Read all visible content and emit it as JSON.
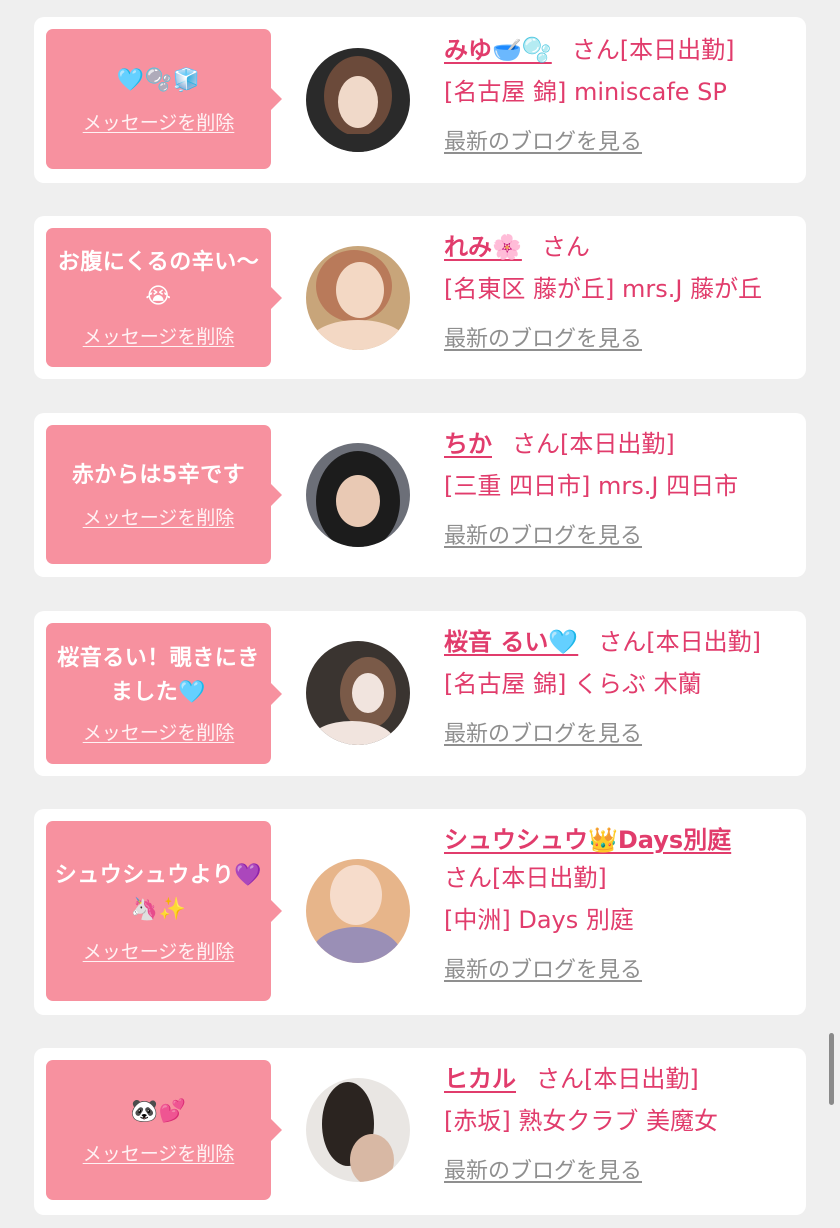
{
  "messages": [
    {
      "message": "🩵🫧🧊",
      "delete_label": "メッセージを削除",
      "name": "みゆ🥣🫧",
      "suffix": "さん[本日出勤]",
      "shop": "[名古屋 錦] miniscafe SP",
      "blog_label": "最新のブログを見る",
      "avatar_colors": [
        "#f0d9c9",
        "#6b4a3a",
        "#2a2a2a"
      ]
    },
    {
      "message": "お腹にくるの辛い〜😭",
      "delete_label": "メッセージを削除",
      "name": "れみ🌸",
      "suffix": "さん",
      "shop": "[名東区 藤が丘] mrs.J 藤が丘",
      "blog_label": "最新のブログを見る",
      "avatar_colors": [
        "#f3d8c4",
        "#b97a5a",
        "#c8a57a"
      ]
    },
    {
      "message": "赤からは5辛です",
      "delete_label": "メッセージを削除",
      "name": "ちか",
      "suffix": "さん[本日出勤]",
      "shop": "[三重 四日市] mrs.J 四日市",
      "blog_label": "最新のブログを見る",
      "avatar_colors": [
        "#6c6f78",
        "#1c1c1c",
        "#e9c9b4"
      ]
    },
    {
      "message": "桜音るい！覗きにきました🩵",
      "delete_label": "メッセージを削除",
      "name": "桜音 るい🩵",
      "suffix": "さん[本日出勤]",
      "shop": "[名古屋 錦] くらぶ 木蘭",
      "blog_label": "最新のブログを見る",
      "avatar_colors": [
        "#3a3430",
        "#f1e4de",
        "#7a5a48"
      ]
    },
    {
      "message": "シュウシュウより💜🦄✨",
      "delete_label": "メッセージを削除",
      "name": "シュウシュウ👑Days別庭",
      "suffix": "さん[本日出勤]",
      "shop": "[中洲] Days 別庭",
      "blog_label": "最新のブログを見る",
      "avatar_colors": [
        "#e7b58a",
        "#9a8fb6",
        "#f6dccb"
      ]
    },
    {
      "message": "🐼💕",
      "delete_label": "メッセージを削除",
      "name": "ヒカル",
      "suffix": "さん[本日出勤]",
      "shop": "[赤坂] 熟女クラブ 美魔女",
      "blog_label": "最新のブログを見る",
      "avatar_colors": [
        "#e9e6e3",
        "#2b2420",
        "#d8b8a4"
      ]
    }
  ]
}
